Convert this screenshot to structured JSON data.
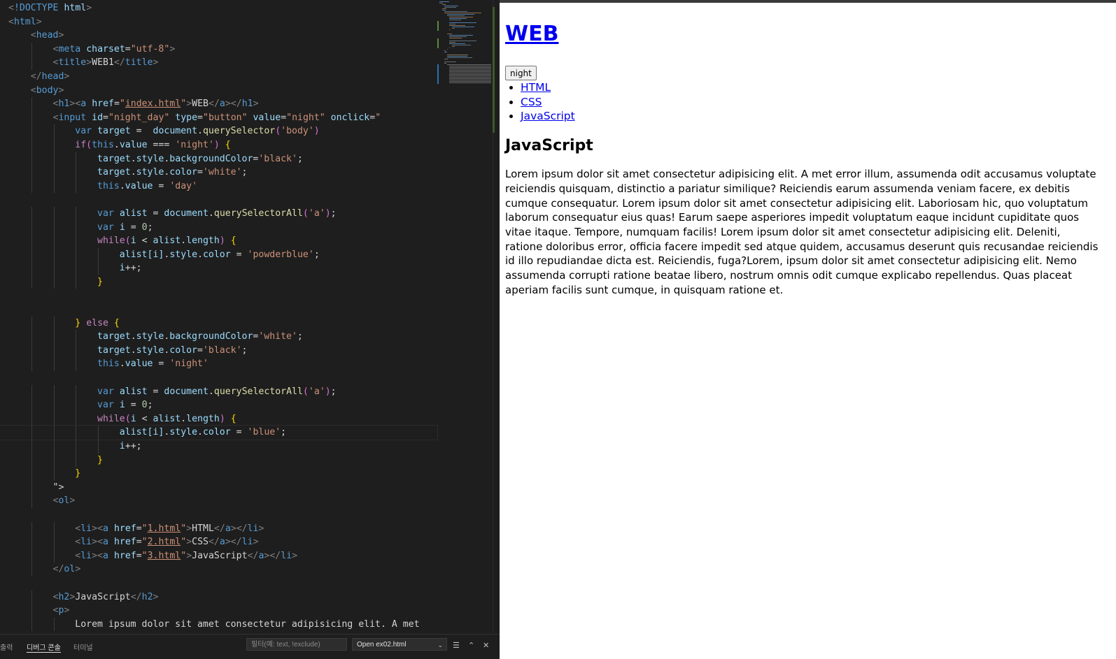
{
  "editor": {
    "code_lines": [
      "<!DOCTYPE html>",
      "<html>",
      "    <head>",
      "        <meta charset=\"utf-8\">",
      "        <title>WEB1</title>",
      "    </head>",
      "    <body>",
      "        <h1><a href=\"index.html\">WEB</a></h1>",
      "        <input id=\"night_day\" type=\"button\" value=\"night\" onclick=\"",
      "            var target =  document.querySelector('body')",
      "            if(this.value === 'night') {",
      "                target.style.backgroundColor='black';",
      "                target.style.color='white';",
      "                this.value = 'day'",
      "",
      "                var alist = document.querySelectorAll('a');",
      "                var i = 0;",
      "                while(i < alist.length) {",
      "                    alist[i].style.color = 'powderblue';",
      "                    i++;",
      "                }",
      "",
      "",
      "            } else {",
      "                target.style.backgroundColor='white';",
      "                target.style.color='black';",
      "                this.value = 'night'",
      "",
      "                var alist = document.querySelectorAll('a');",
      "                var i = 0;",
      "                while(i < alist.length) {",
      "                    alist[i].style.color = 'blue';",
      "                    i++;",
      "                }",
      "            }",
      "        \">",
      "        <ol>",
      "",
      "            <li><a href=\"1.html\">HTML</a></li>",
      "            <li><a href=\"2.html\">CSS</a></li>",
      "            <li><a href=\"3.html\">JavaScript</a></li>",
      "        </ol>",
      "",
      "        <h2>JavaScript</h2>",
      "        <p>",
      "            Lorem ipsum dolor sit amet consectetur adipisicing elit. A met"
    ]
  },
  "panel": {
    "tabs": [
      "출력",
      "디버그 콘솔",
      "터미널"
    ],
    "filter_placeholder": "필터(예: text, !exclude)",
    "open_select": "Open ex02.html"
  },
  "preview": {
    "title_link": "WEB",
    "button_value": "night",
    "list_items": [
      "HTML",
      "CSS",
      "JavaScript"
    ],
    "heading": "JavaScript",
    "paragraph": "Lorem ipsum dolor sit amet consectetur adipisicing elit. A met error illum, assumenda odit accusamus voluptate reiciendis quisquam, distinctio a pariatur similique? Reiciendis earum assumenda veniam facere, ex debitis cumque consequatur. Lorem ipsum dolor sit amet consectetur adipisicing elit. Laboriosam hic, quo voluptatum laborum consequatur eius quas! Earum saepe asperiores impedit voluptatum eaque incidunt cupiditate quos vitae itaque. Tempore, numquam facilis! Lorem ipsum dolor sit amet consectetur adipisicing elit. Deleniti, ratione doloribus error, officia facere impedit sed atque quidem, accusamus deserunt quis recusandae reiciendis id illo repudiandae dicta est. Reiciendis, fuga?Lorem, ipsum dolor sit amet consectetur adipisicing elit. Nemo assumenda corrupti ratione beatae libero, nostrum omnis odit cumque explicabo repellendus. Quas placeat aperiam facilis sunt cumque, in quisquam ratione et."
  },
  "colors": {
    "editor_bg": "#1e1e1e",
    "tag": "#569cd6",
    "attribute": "#9cdcfe",
    "string": "#ce9178",
    "keyword_control": "#c586c0",
    "method": "#dcdcaa",
    "number": "#b5cea8",
    "link": "#0000ee"
  }
}
